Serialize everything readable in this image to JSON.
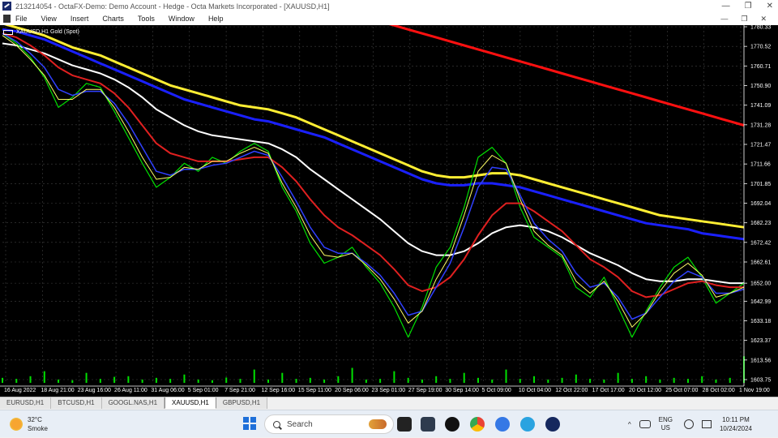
{
  "window": {
    "title": "213214054 - OctaFX-Demo: Demo Account - Hedge - Octa Markets Incorporated - [XAUUSD,H1]",
    "controls": [
      "—",
      "❐",
      "✕"
    ]
  },
  "menu": {
    "items": [
      "File",
      "View",
      "Insert",
      "Charts",
      "Tools",
      "Window",
      "Help"
    ],
    "controls": [
      "—",
      "❐",
      "✕"
    ]
  },
  "chart": {
    "header": "XAUUSD,H1  Gold (Spot)",
    "colors": {
      "background": "#000000",
      "price": "#00e000",
      "grid": "#404040",
      "ma_fast": "#ffff66",
      "ma_blue_fast": "#3040ff",
      "ma_red": "#e02020",
      "ma_white": "#ffffff",
      "ma_yellow_slow": "#ffee33",
      "ma_blue_slow": "#1a20ff",
      "ma_red_slow": "#ff1010",
      "volume": "#00e000"
    }
  },
  "chart_data": {
    "type": "line",
    "title": "XAUUSD,H1 Gold (Spot)",
    "ylim": [
      1603.75,
      1780.33
    ],
    "y_ticks": [
      "1780.33",
      "1770.52",
      "1760.71",
      "1750.90",
      "1741.09",
      "1731.28",
      "1721.47",
      "1711.66",
      "1701.85",
      "1692.04",
      "1682.23",
      "1672.42",
      "1662.61",
      "1652.00",
      "1642.99",
      "1633.18",
      "1623.37",
      "1613.56",
      "1603.75"
    ],
    "x_ticks": [
      "16 Aug 2022",
      "18 Aug 21:00",
      "23 Aug 16:00",
      "26 Aug 11:00",
      "31 Aug 06:00",
      "5 Sep 01:00",
      "7 Sep 21:00",
      "12 Sep 16:00",
      "15 Sep 11:00",
      "20 Sep 06:00",
      "23 Sep 01:00",
      "27 Sep 19:00",
      "30 Sep 14:00",
      "5 Oct 09:00",
      "10 Oct 04:00",
      "12 Oct 22:00",
      "17 Oct 17:00",
      "20 Oct 12:00",
      "25 Oct 07:00",
      "28 Oct 02:00",
      "1 Nov 19:00"
    ],
    "price": [
      1777,
      1772,
      1765,
      1755,
      1740,
      1745,
      1752,
      1750,
      1738,
      1725,
      1712,
      1700,
      1705,
      1712,
      1708,
      1715,
      1712,
      1718,
      1722,
      1718,
      1700,
      1688,
      1672,
      1662,
      1665,
      1670,
      1660,
      1652,
      1640,
      1625,
      1640,
      1660,
      1670,
      1690,
      1715,
      1720,
      1712,
      1690,
      1675,
      1670,
      1665,
      1650,
      1645,
      1655,
      1640,
      1625,
      1638,
      1650,
      1660,
      1665,
      1655,
      1642,
      1647,
      1652
    ],
    "ma_fast": [
      1776,
      1771,
      1764,
      1756,
      1744,
      1744,
      1749,
      1749,
      1740,
      1728,
      1715,
      1704,
      1705,
      1710,
      1709,
      1713,
      1713,
      1717,
      1720,
      1717,
      1702,
      1690,
      1676,
      1666,
      1665,
      1667,
      1661,
      1654,
      1644,
      1632,
      1638,
      1654,
      1666,
      1686,
      1708,
      1716,
      1712,
      1694,
      1678,
      1671,
      1666,
      1653,
      1647,
      1653,
      1643,
      1630,
      1637,
      1648,
      1657,
      1662,
      1656,
      1645,
      1647,
      1650
    ],
    "ma_blue_fast": [
      1777,
      1773,
      1767,
      1760,
      1749,
      1746,
      1748,
      1748,
      1742,
      1732,
      1720,
      1708,
      1706,
      1709,
      1709,
      1711,
      1712,
      1715,
      1718,
      1716,
      1705,
      1693,
      1680,
      1670,
      1667,
      1667,
      1662,
      1656,
      1647,
      1636,
      1638,
      1650,
      1662,
      1680,
      1700,
      1710,
      1709,
      1696,
      1682,
      1674,
      1668,
      1657,
      1650,
      1652,
      1645,
      1634,
      1637,
      1645,
      1653,
      1658,
      1655,
      1647,
      1647,
      1649
    ],
    "ma_red": [
      1777,
      1775,
      1771,
      1766,
      1760,
      1756,
      1754,
      1752,
      1747,
      1740,
      1731,
      1722,
      1717,
      1715,
      1713,
      1713,
      1713,
      1714,
      1715,
      1715,
      1710,
      1703,
      1694,
      1686,
      1680,
      1676,
      1671,
      1666,
      1659,
      1651,
      1648,
      1650,
      1655,
      1664,
      1676,
      1686,
      1692,
      1692,
      1688,
      1683,
      1678,
      1671,
      1664,
      1660,
      1655,
      1648,
      1645,
      1646,
      1649,
      1652,
      1653,
      1651,
      1650,
      1650
    ],
    "ma_white": [
      1772,
      1771,
      1769,
      1767,
      1764,
      1761,
      1759,
      1757,
      1754,
      1750,
      1745,
      1739,
      1735,
      1731,
      1728,
      1726,
      1725,
      1724,
      1723,
      1722,
      1719,
      1715,
      1709,
      1704,
      1699,
      1694,
      1689,
      1684,
      1678,
      1672,
      1668,
      1666,
      1666,
      1668,
      1672,
      1677,
      1680,
      1681,
      1680,
      1678,
      1675,
      1671,
      1667,
      1664,
      1661,
      1657,
      1654,
      1653,
      1653,
      1654,
      1654,
      1653,
      1652,
      1652
    ],
    "ma_yellow_slow": [
      1782,
      1780,
      1778,
      1776,
      1773,
      1770,
      1768,
      1766,
      1763,
      1760,
      1757,
      1754,
      1751,
      1749,
      1747,
      1745,
      1743,
      1741,
      1740,
      1739,
      1737,
      1735,
      1732,
      1729,
      1726,
      1723,
      1720,
      1717,
      1714,
      1711,
      1708,
      1706,
      1705,
      1705,
      1706,
      1707,
      1707,
      1706,
      1704,
      1702,
      1700,
      1698,
      1696,
      1694,
      1692,
      1690,
      1688,
      1686,
      1685,
      1684,
      1683,
      1682,
      1681,
      1680
    ],
    "ma_blue_slow": [
      1779,
      1778,
      1776,
      1774,
      1771,
      1768,
      1765,
      1762,
      1759,
      1756,
      1753,
      1750,
      1747,
      1744,
      1742,
      1740,
      1738,
      1736,
      1734,
      1733,
      1731,
      1729,
      1727,
      1725,
      1722,
      1719,
      1716,
      1713,
      1710,
      1707,
      1704,
      1702,
      1701,
      1701,
      1702,
      1702,
      1701,
      1700,
      1698,
      1696,
      1694,
      1692,
      1690,
      1688,
      1686,
      1684,
      1682,
      1681,
      1680,
      1679,
      1677,
      1676,
      1675,
      1674
    ],
    "ma_red_slow_segment": {
      "x_start_index": 27,
      "values": [
        1783,
        1781,
        1779,
        1777,
        1775,
        1773,
        1771,
        1769,
        1767,
        1765,
        1763,
        1761,
        1759,
        1757,
        1755,
        1753,
        1751,
        1749,
        1747,
        1745,
        1743,
        1741,
        1739,
        1737,
        1735,
        1733,
        1731
      ]
    },
    "volume": [
      0.15,
      0.12,
      0.2,
      0.35,
      0.1,
      0.08,
      0.3,
      0.12,
      0.18,
      0.2,
      0.1,
      0.15,
      0.12,
      0.25,
      0.1,
      0.08,
      0.16,
      0.12,
      0.4,
      0.1,
      0.3,
      0.12,
      0.15,
      0.1,
      0.2,
      0.45,
      0.1,
      0.12,
      0.35,
      0.15,
      0.1,
      0.2,
      0.12,
      0.3,
      0.15,
      0.1,
      0.4,
      0.12,
      0.2,
      0.1,
      0.15,
      0.25,
      0.12,
      0.1,
      0.3,
      0.12,
      0.2,
      0.1,
      0.15,
      0.12,
      0.2,
      0.1,
      0.15,
      0.8
    ]
  },
  "tabs": [
    {
      "label": "EURUSD,H1",
      "active": false
    },
    {
      "label": "BTCUSD,H1",
      "active": false
    },
    {
      "label": "GOOGL.NAS,H1",
      "active": false
    },
    {
      "label": "XAUUSD,H1",
      "active": true
    },
    {
      "label": "GBPUSD,H1",
      "active": false
    }
  ],
  "taskbar": {
    "weather_temp": "32°C",
    "weather_desc": "Smoke",
    "search_placeholder": "Search",
    "lang_line1": "ENG",
    "lang_line2": "US",
    "time": "10:11 PM",
    "date": "10/24/2024",
    "tray_up": "^",
    "apps": [
      "leaf-app",
      "task-view",
      "video-app",
      "media-player",
      "chrome",
      "browser-2",
      "telegram",
      "metatrader"
    ]
  }
}
